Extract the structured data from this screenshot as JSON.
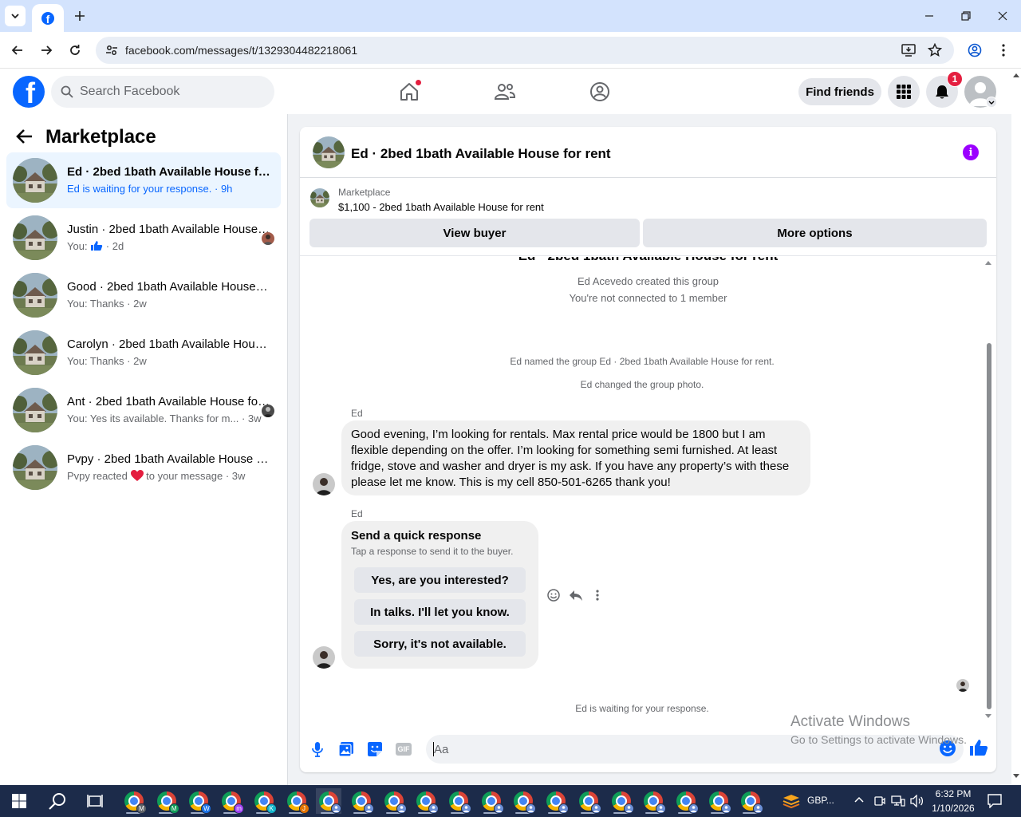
{
  "browser": {
    "url": "facebook.com/messages/t/1329304482218061"
  },
  "fb": {
    "search_placeholder": "Search Facebook",
    "find_friends": "Find friends",
    "notification_count": "1"
  },
  "left": {
    "title": "Marketplace",
    "conversations": [
      {
        "name": "Ed · 2bed 1bath Available House for rent",
        "sub": "Ed is waiting for your response.",
        "time": "9h"
      },
      {
        "name": "Justin · 2bed 1bath Available House for rent",
        "sub": "You:",
        "time": "2d"
      },
      {
        "name": "Good · 2bed 1bath Available House for rent",
        "sub": "You: Thanks",
        "time": "2w"
      },
      {
        "name": "Carolyn · 2bed 1bath Available House for rent",
        "sub": "You: Thanks",
        "time": "2w"
      },
      {
        "name": "Ant · 2bed 1bath Available House for rent",
        "sub": "You: Yes its available. Thanks for m...",
        "time": "3w"
      },
      {
        "name": "Pvpy · 2bed 1bath Available House for rent",
        "sub_a": "Pvpy reacted",
        "sub_b": "to your message",
        "time": "3w"
      }
    ]
  },
  "chat": {
    "title": "Ed · 2bed 1bath Available House for rent",
    "marketplace_label": "Marketplace",
    "listing": "$1,100 - 2bed 1bath Available House for rent",
    "view_buyer": "View buyer",
    "more_options": "More options",
    "group_title": "Ed · 2bed 1bath Available House for rent",
    "created": "Ed Acevedo created this group",
    "not_connected": "You're not connected to 1 member",
    "named": "Ed named the group Ed · 2bed 1bath Available House for rent.",
    "changed_photo": "Ed changed the group photo.",
    "sender1": "Ed",
    "message1": "Good evening, I’m looking for rentals. Max rental price would be 1800 but I am flexible depending on the offer. I’m looking for something semi furnished. At least fridge, stove and washer and dryer is my ask. If you have any property’s with these please let me know. This is my cell 850-501-6265 thank you!",
    "sender2": "Ed",
    "qr_title": "Send a quick response",
    "qr_sub": "Tap a response to send it to the buyer.",
    "qr_options": [
      "Yes, are you interested?",
      "In talks. I'll let you know.",
      "Sorry, it's not available."
    ],
    "waiting": "Ed is waiting for your response.",
    "composer_placeholder": "Aa",
    "gif_label": "GIF"
  },
  "windows": {
    "activate_title": "Activate Windows",
    "activate_sub": "Go to Settings to activate Windows.",
    "tray_label": "GBP...",
    "time": "6:32 PM",
    "date": "1/10/2026",
    "chrome_profiles": [
      "M",
      "M",
      "W",
      "m",
      "K",
      "J"
    ]
  },
  "colors": {
    "fb_blue": "#0866ff",
    "selected_row": "#ebf5ff",
    "badge_red": "#e41e3f",
    "info_purple": "#9b00ff"
  }
}
